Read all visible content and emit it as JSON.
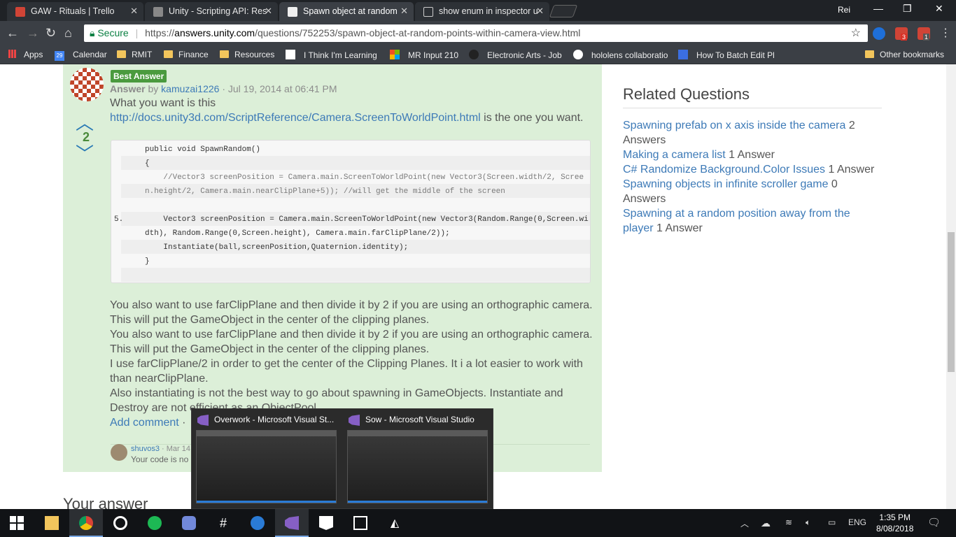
{
  "tabs": [
    {
      "title": "GAW - Rituals | Trello",
      "color": "#d04436"
    },
    {
      "title": "Unity - Scripting API: Res",
      "color": "#555"
    },
    {
      "title": "Spawn object at random",
      "color": "#222"
    },
    {
      "title": "show enum in inspector u",
      "color": "#fff"
    }
  ],
  "user": "Rei",
  "address": {
    "secure_label": "Secure",
    "scheme": "https://",
    "host": "answers.unity.com",
    "path": "/questions/752253/spawn-object-at-random-points-within-camera-view.html"
  },
  "bookmarks": [
    "Apps",
    "Calendar",
    "RMIT",
    "Finance",
    "Resources",
    "I Think I'm Learning",
    "MR Input 210",
    "Electronic Arts - Job",
    "hololens collaboratio",
    "How To Batch Edit Pl",
    "Other bookmarks"
  ],
  "bookmark_calendar_day": "29",
  "ext_badges": [
    "3",
    "1"
  ],
  "answer": {
    "badge": "Best Answer",
    "label": "Answer",
    "by": "by",
    "author": "kamuzai1226",
    "date": "· Jul 19, 2014 at 06:41 PM",
    "score": "2",
    "intro": "What you want is this",
    "link": "http://docs.unity3d.com/ScriptReference/Camera.ScreenToWorldPoint.html",
    "intro_tail": " is the one you want.",
    "code": [
      {
        "n": "",
        "t": "public void SpawnRandom()"
      },
      {
        "n": "",
        "t": "{"
      },
      {
        "n": "",
        "t": "    //Vector3 screenPosition = Camera.main.ScreenToWorldPoint(new Vector3(Screen.width/2, Scree"
      },
      {
        "n": "",
        "t": "n.height/2, Camera.main.nearClipPlane+5)); //will get the middle of the screen"
      },
      {
        "n": "",
        "t": ""
      },
      {
        "n": "5.",
        "t": "    Vector3 screenPosition = Camera.main.ScreenToWorldPoint(new Vector3(Random.Range(0,Screen.wi"
      },
      {
        "n": "",
        "t": "dth), Random.Range(0,Screen.height), Camera.main.farClipPlane/2));"
      },
      {
        "n": "",
        "t": "    Instantiate(ball,screenPosition,Quaternion.identity);"
      },
      {
        "n": "",
        "t": "}"
      },
      {
        "n": "",
        "t": ""
      }
    ],
    "para1": "You also want to use farClipPlane and then divide it by 2 if you are using an orthographic camera. This will put the GameObject in the center of the clipping planes.",
    "para2": "You also want to use farClipPlane and then divide it by 2 if you are using an orthographic camera. This will put the GameObject in the center of the clipping planes.",
    "para3": "I use farClipPlane/2 in order to get the center of the Clipping Planes. It i a lot easier to work with than nearClipPlane.",
    "para4": "Also instantiating is not the best way to go about spawning in GameObjects. Instantiate and Destroy are not efficient as an ObjectPool",
    "add_comment": "Add comment",
    "add_comment_sep": "·"
  },
  "comment": {
    "author": "shuvos3",
    "date": "· Mar 14",
    "text": "Your code is no"
  },
  "your_answer": "Your answer",
  "related": {
    "title": "Related Questions",
    "items": [
      {
        "q": "Spawning prefab on x axis inside the camera",
        "a": " 2 Answers"
      },
      {
        "q": "Making a camera list",
        "a": " 1 Answer"
      },
      {
        "q": "C# Randomize Background.Color Issues",
        "a": " 1 Answer"
      },
      {
        "q": "Spawning objects in infinite scroller game",
        "a": " 0 Answers"
      },
      {
        "q": "Spawning at a random position away from the player",
        "a": " 1 Answer"
      }
    ]
  },
  "previews": [
    {
      "title": "Overwork - Microsoft Visual St..."
    },
    {
      "title": "Sow - Microsoft Visual Studio"
    }
  ],
  "tray": {
    "lang": "ENG",
    "time": "1:35 PM",
    "date": "8/08/2018"
  }
}
